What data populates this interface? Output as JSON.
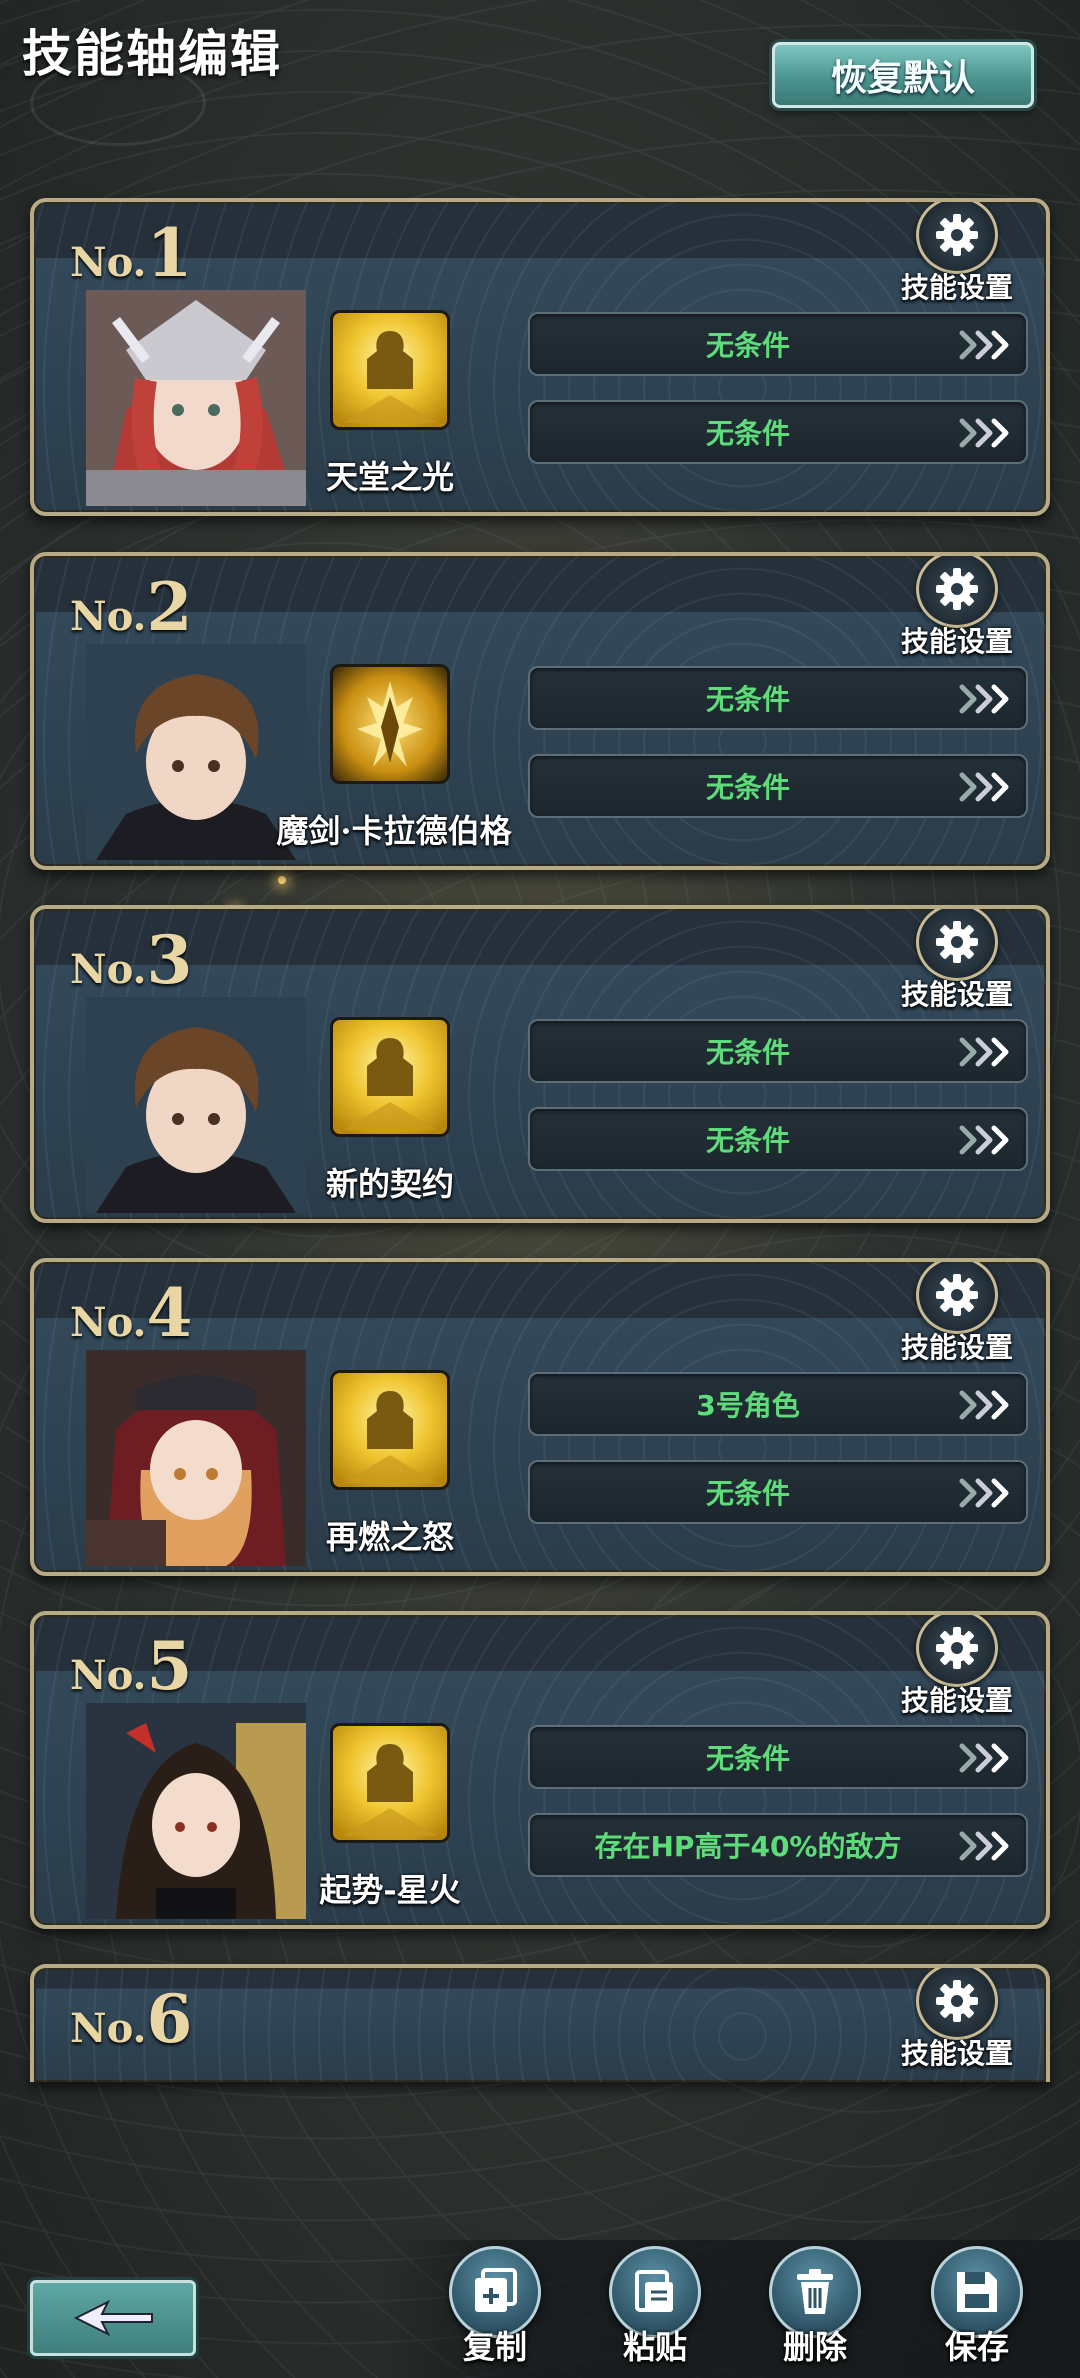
{
  "header": {
    "title": "技能轴编辑",
    "restore_label": "恢复默认"
  },
  "gear_label": "技能设置",
  "cards": [
    {
      "no_prefix": "No.",
      "no": "1",
      "skill": "天堂之光",
      "cond1": "无条件",
      "cond2": "无条件"
    },
    {
      "no_prefix": "No.",
      "no": "2",
      "skill": "魔剑·卡拉德伯格",
      "cond1": "无条件",
      "cond2": "无条件"
    },
    {
      "no_prefix": "No.",
      "no": "3",
      "skill": "新的契约",
      "cond1": "无条件",
      "cond2": "无条件"
    },
    {
      "no_prefix": "No.",
      "no": "4",
      "skill": "再燃之怒",
      "cond1": "3号角色",
      "cond2": "无条件"
    },
    {
      "no_prefix": "No.",
      "no": "5",
      "skill": "起势-星火",
      "cond1": "无条件",
      "cond2": "存在HP高于40%的敌方"
    },
    {
      "no_prefix": "No.",
      "no": "6"
    }
  ],
  "toolbar": {
    "copy": "复制",
    "paste": "粘贴",
    "delete": "删除",
    "save": "保存"
  },
  "colors": {
    "condition_text": "#5fdc7a",
    "gold": "#e8d6a4",
    "frame": "#b7ab86",
    "teal_button": "#4c958f"
  }
}
